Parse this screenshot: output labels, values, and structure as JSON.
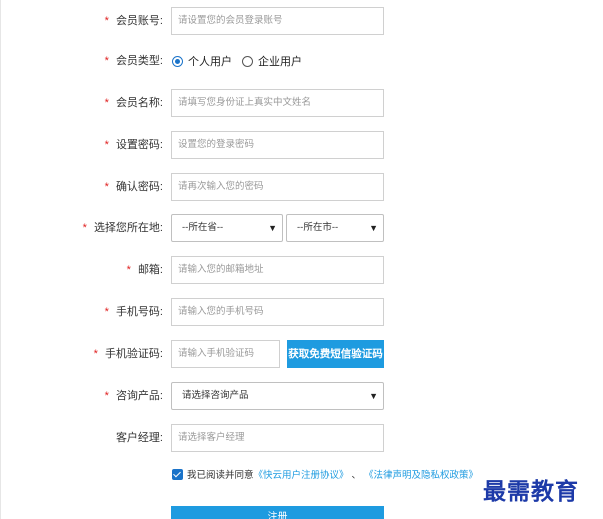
{
  "form": {
    "required_mark": "*",
    "account": {
      "label": "会员账号:",
      "placeholder": "请设置您的会员登录账号"
    },
    "member_type": {
      "label": "会员类型:",
      "options": [
        "个人用户",
        "企业用户"
      ],
      "selected": "个人用户"
    },
    "member_name": {
      "label": "会员名称:",
      "placeholder": "请填写您身份证上真实中文姓名"
    },
    "password": {
      "label": "设置密码:",
      "placeholder": "设置您的登录密码"
    },
    "confirm_password": {
      "label": "确认密码:",
      "placeholder": "请再次输入您的密码"
    },
    "location": {
      "label": "选择您所在地:",
      "province": "--所在省--",
      "city": "--所在市--"
    },
    "email": {
      "label": "邮箱:",
      "placeholder": "请输入您的邮箱地址"
    },
    "phone": {
      "label": "手机号码:",
      "placeholder": "请输入您的手机号码"
    },
    "sms_code": {
      "label": "手机验证码:",
      "placeholder": "请输入手机验证码",
      "button": "获取免费短信验证码"
    },
    "product": {
      "label": "咨询产品:",
      "selected": "请选择咨询产品"
    },
    "manager": {
      "label": "客户经理:",
      "placeholder": "请选择客户经理"
    },
    "agreement": {
      "checked": true,
      "prefix": "我已阅读并同意",
      "link1": "《快云用户注册协议》",
      "separator": "、",
      "link2": "《法律声明及隐私权政策》"
    },
    "submit_label": "注册"
  },
  "watermark": "最需教育",
  "colors": {
    "accent": "#1e9be0",
    "required": "#e02020",
    "watermark": "#1d3aa8"
  }
}
